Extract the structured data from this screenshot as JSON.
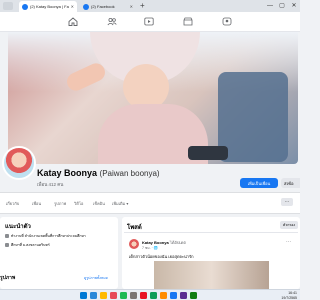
{
  "browser": {
    "tabs": [
      {
        "title": "(2) Katay Boonya | Facebook",
        "active": true
      },
      {
        "title": "(2) Facebook",
        "active": false
      }
    ],
    "new_tab": "+",
    "window_controls": [
      "—",
      "▢",
      "✕"
    ]
  },
  "fb_nav": {
    "icons": [
      "home-icon",
      "friends-icon",
      "watch-icon",
      "marketplace-icon",
      "groups-icon"
    ]
  },
  "profile": {
    "name": "Katay Boonya",
    "alt_name": "(Paiwan boonya)",
    "friends_count": "เพื่อน 412 คน",
    "add_friend": "เพิ่มเป็นเพื่อน",
    "message": "ส่งข้อ"
  },
  "profile_tabs": [
    "เกี่ยวกับ",
    "เพื่อน",
    "รูปภาพ",
    "วิดีโอ",
    "เช็คอิน",
    "เพิ่มเติม ▾"
  ],
  "more_dots": "···",
  "intro": {
    "title": "แนะนำตัว",
    "lines": [
      "ทำงานที่ สำนักงานเขตพื้นที่การศึกษาประถมศึกษา",
      "ศึกษาที่ ม.สงขลานครินทร์"
    ]
  },
  "photos": {
    "title": "รูปภาพ",
    "see_all": "ดูรูปภาพทั้งหมด"
  },
  "posts": {
    "title": "โพสต์",
    "filters": "ตัวกรอง",
    "author": "Katay Boonya",
    "update": "ได้อัปเดต",
    "time": "7 ชม. · 🌐",
    "text": "เด็กสาวตัวน้อยของฉัน เธอสุดจะน่ารัก",
    "more": "···"
  },
  "taskbar": {
    "time": "16:41",
    "date": "19/7/2565",
    "colors": [
      "#0078d4",
      "#2b88d8",
      "#ffb900",
      "#e74856",
      "#1db954",
      "#7a7574",
      "#e81123",
      "#0f9d58",
      "#ff8c00",
      "#1877f2",
      "#5c2d91",
      "#107c10"
    ]
  },
  "colors": {
    "fb_blue": "#1877f2",
    "bg": "#f0f2f5"
  }
}
